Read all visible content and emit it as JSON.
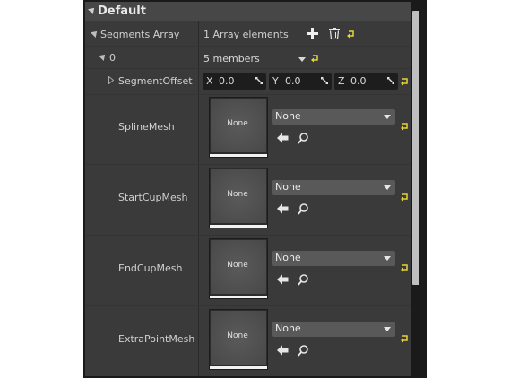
{
  "section": {
    "title": "Default"
  },
  "segments_array": {
    "label": "Segments Array",
    "count_text": "1 Array elements",
    "add_icon": "plus-icon",
    "delete_icon": "trash-icon",
    "reset_icon": "reset-arrow-icon"
  },
  "element0": {
    "index_label": "0",
    "members_text": "5 members"
  },
  "segment_offset": {
    "label": "SegmentOffset",
    "x_axis": "X",
    "x_value": "0.0",
    "y_axis": "Y",
    "y_value": "0.0",
    "z_axis": "Z",
    "z_value": "0.0"
  },
  "mesh_rows": [
    {
      "label": "SplineMesh",
      "thumb_text": "None",
      "value": "None"
    },
    {
      "label": "StartCupMesh",
      "thumb_text": "None",
      "value": "None"
    },
    {
      "label": "EndCupMesh",
      "thumb_text": "None",
      "value": "None"
    },
    {
      "label": "ExtraPointMesh",
      "thumb_text": "None",
      "value": "None"
    }
  ],
  "colors": {
    "panel_bg": "#3a3a3a",
    "header_bg": "#474747",
    "reset_yellow": "#e8d23a",
    "scrollbar": "#bfbfbf"
  }
}
